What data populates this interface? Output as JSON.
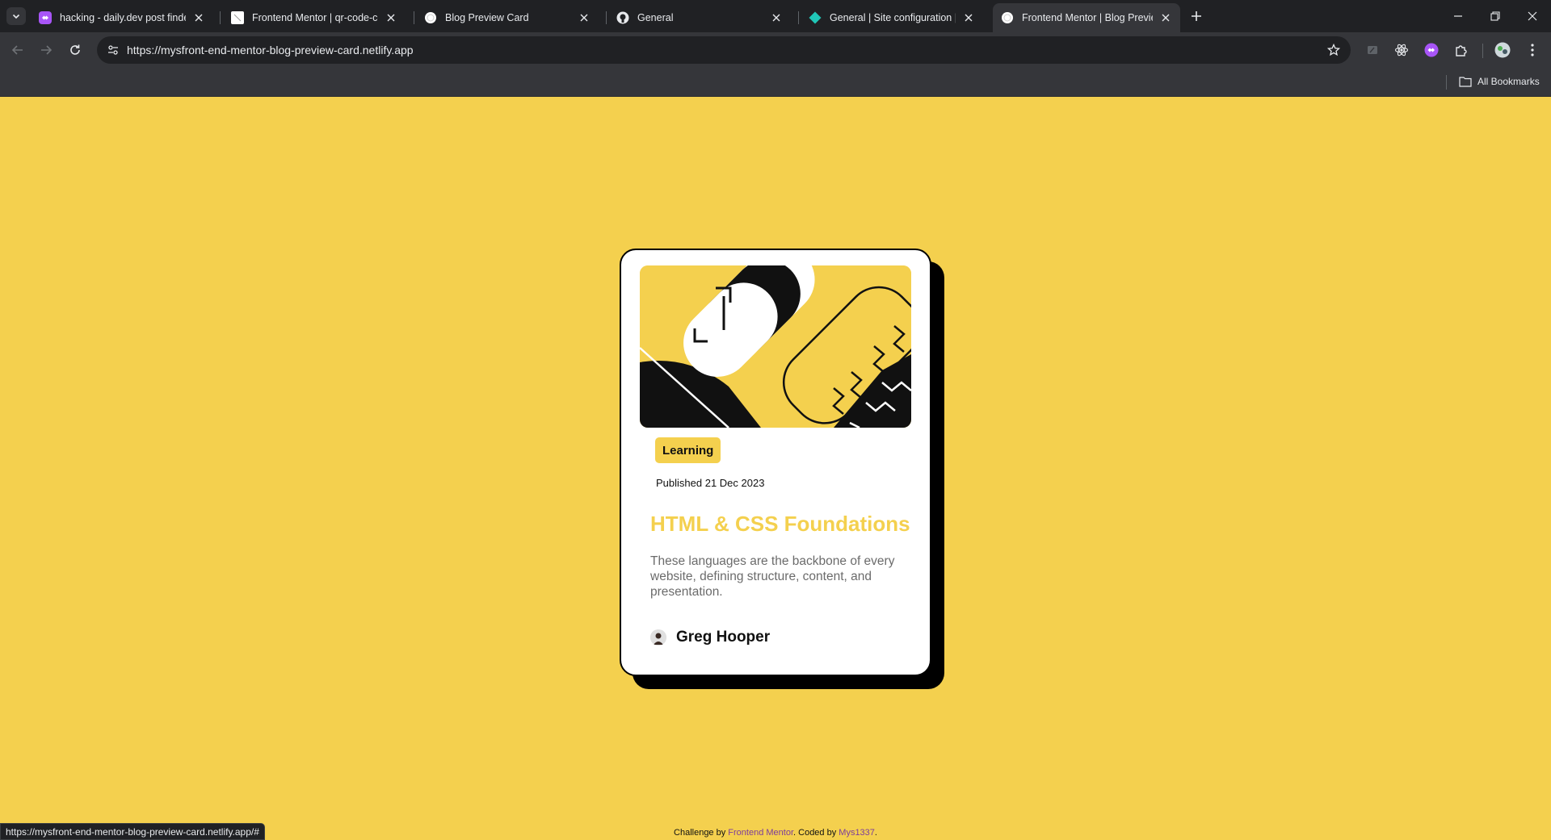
{
  "browser": {
    "tabs": [
      {
        "title": "hacking - daily.dev post finder",
        "favicon": "daily-dev-icon",
        "active": false
      },
      {
        "title": "Frontend Mentor | qr-code-com",
        "favicon": "frontend-mentor-icon",
        "active": false
      },
      {
        "title": "Blog Preview Card",
        "favicon": "globe-icon",
        "active": false
      },
      {
        "title": "General",
        "favicon": "github-icon",
        "active": false
      },
      {
        "title": "General | Site configuration | be",
        "favicon": "netlify-icon",
        "active": false
      },
      {
        "title": "Frontend Mentor | Blog Preview",
        "favicon": "globe-icon",
        "active": true
      }
    ],
    "url": "https://mysfront-end-mentor-blog-preview-card.netlify.app",
    "bookmarks_label": "All Bookmarks",
    "status_url": "https://mysfront-end-mentor-blog-preview-card.netlify.app/#"
  },
  "card": {
    "tag": "Learning",
    "published": "Published 21 Dec 2023",
    "title": "HTML & CSS Foundations",
    "description": "These languages are the backbone of every website, defining structure, content, and presentation.",
    "author": "Greg Hooper"
  },
  "attribution": {
    "prefix": "Challenge by ",
    "challenge_link": "Frontend Mentor",
    "middle": ". Coded by ",
    "author_link": "Mys1337",
    "suffix": "."
  },
  "colors": {
    "background": "#f4d04e",
    "accent": "#f4d04e",
    "chrome_dark": "#202124",
    "chrome_toolbar": "#35363a"
  }
}
